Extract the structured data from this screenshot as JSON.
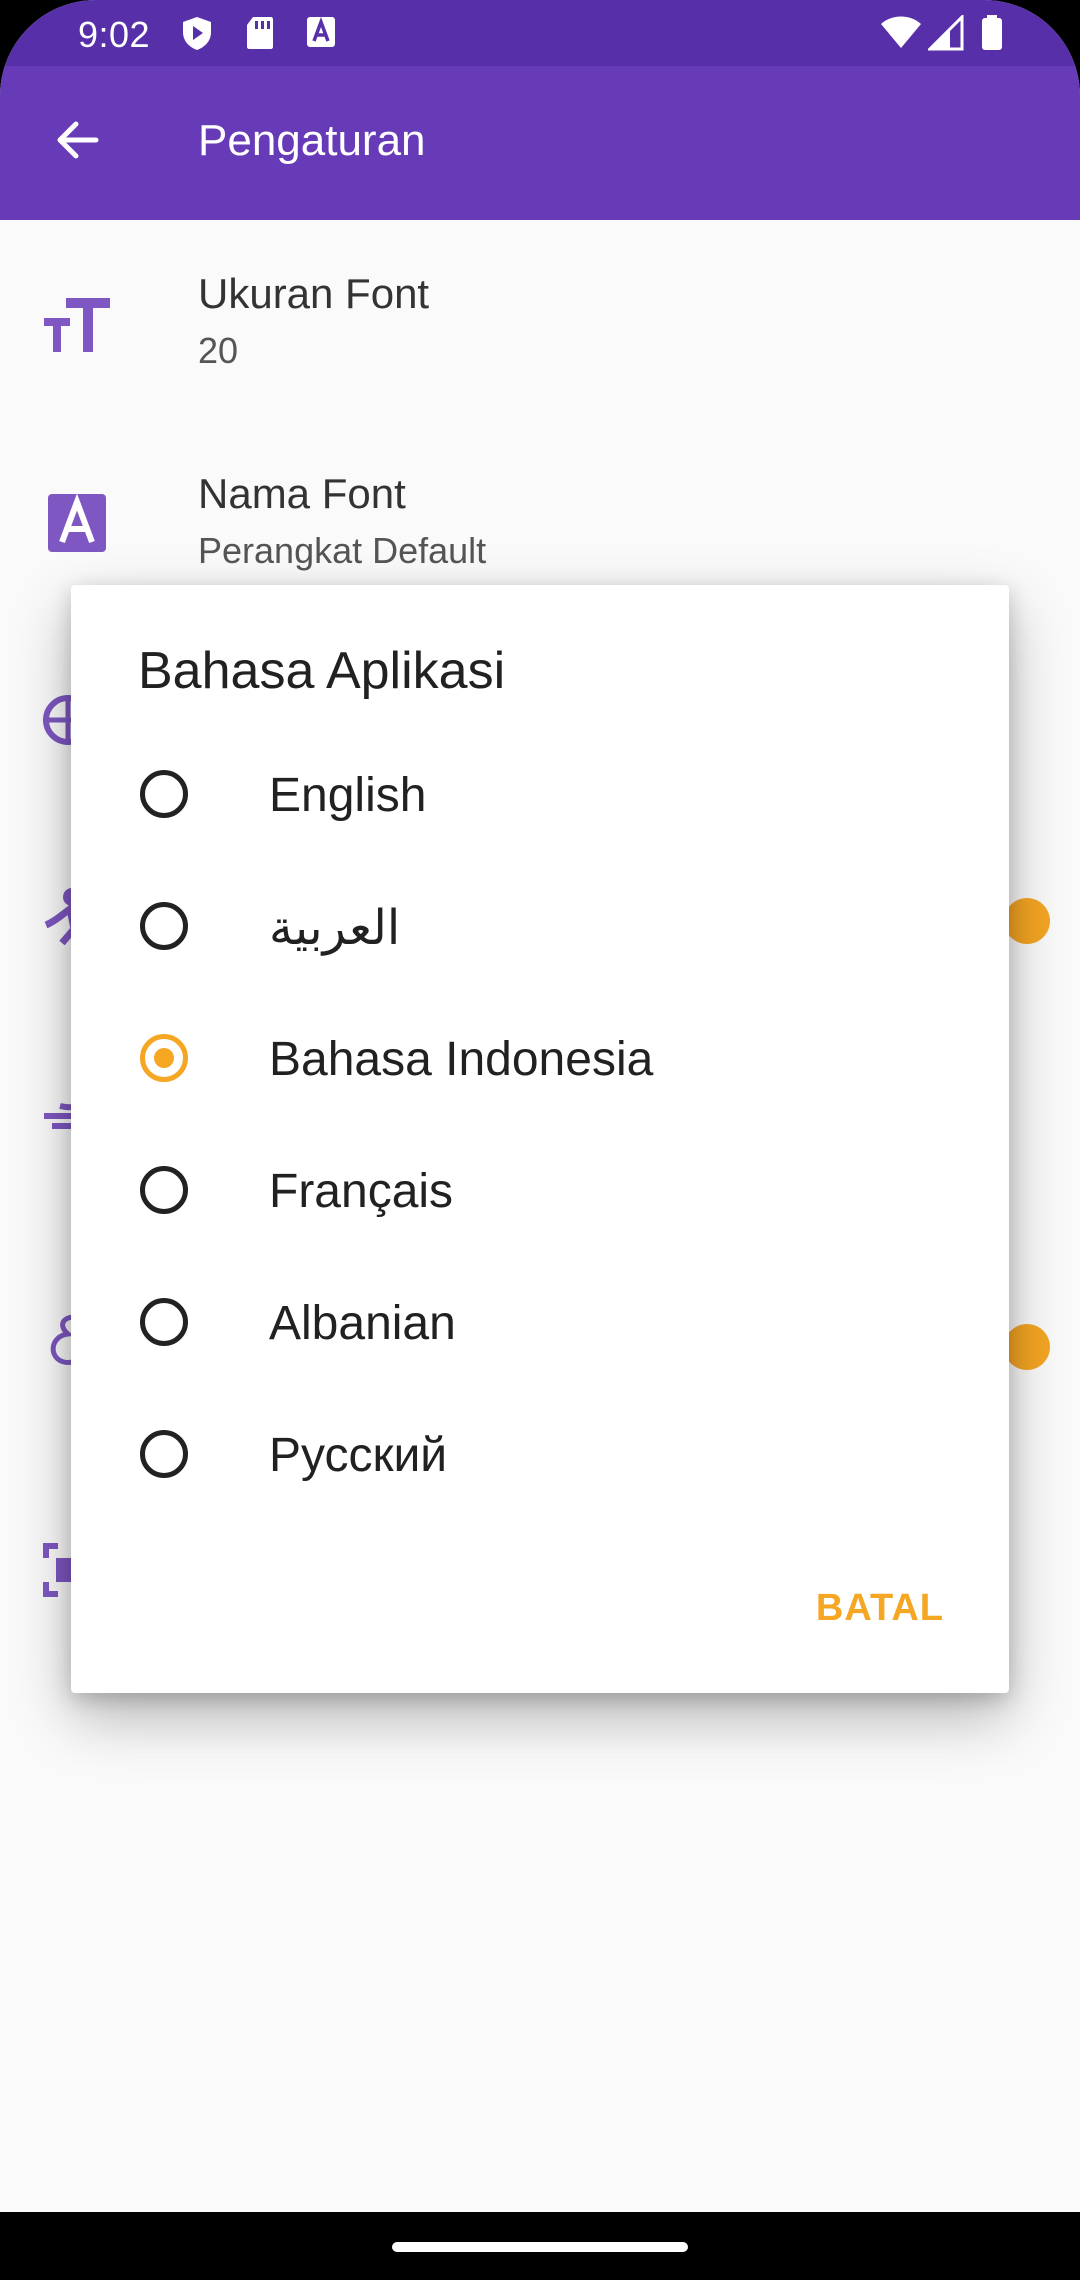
{
  "status_bar": {
    "time": "9:02",
    "icons": [
      "shield-icon",
      "sd-card-icon",
      "a-text-icon",
      "wifi-icon",
      "signal-icon",
      "battery-icon"
    ]
  },
  "app_bar": {
    "title": "Pengaturan",
    "back_icon": "arrow-back-icon",
    "color": "#673ab7"
  },
  "settings": [
    {
      "icon": "font-size-icon",
      "title": "Ukuran Font",
      "value": "20"
    },
    {
      "icon": "font-name-icon",
      "title": "Nama Font",
      "value": "Perangkat Default"
    }
  ],
  "background_icons": [
    "globe-icon",
    "person-icon",
    "translate-icon",
    "arabic-letter-icon",
    "scan-icon"
  ],
  "dialog": {
    "title": "Bahasa Aplikasi",
    "options": [
      {
        "label": "English",
        "selected": false
      },
      {
        "label": "العربية",
        "selected": false
      },
      {
        "label": "Bahasa Indonesia",
        "selected": true
      },
      {
        "label": "Français",
        "selected": false
      },
      {
        "label": "Albanian",
        "selected": false
      },
      {
        "label": "Русский",
        "selected": false
      }
    ],
    "cancel_label": "BATAL",
    "accent_color": "#f5a623"
  }
}
